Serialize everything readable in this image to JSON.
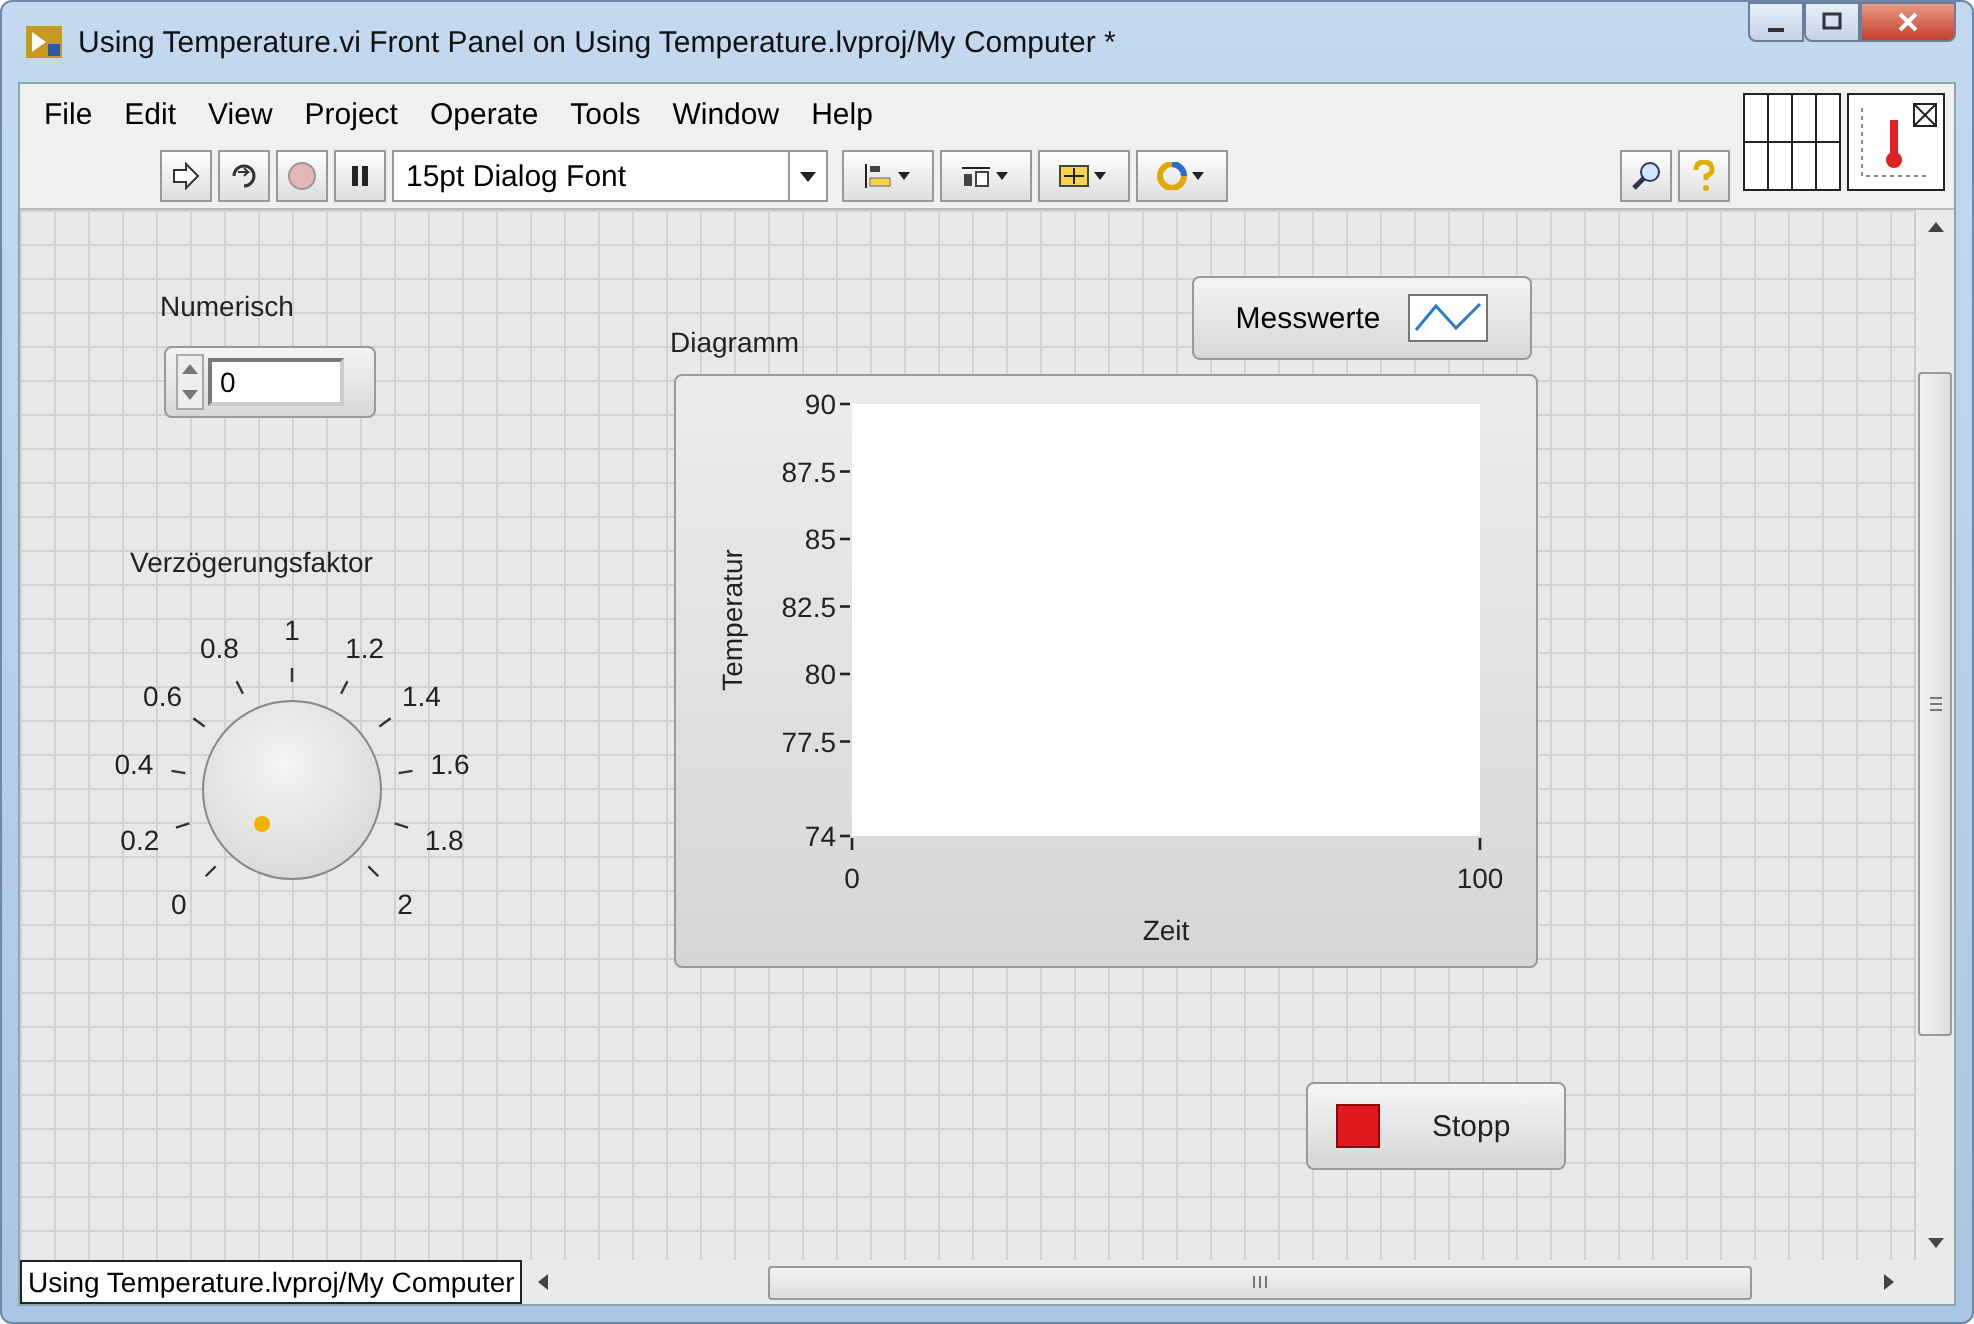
{
  "window": {
    "title": "Using Temperature.vi Front Panel on Using Temperature.lvproj/My Computer *"
  },
  "menu": [
    "File",
    "Edit",
    "View",
    "Project",
    "Operate",
    "Tools",
    "Window",
    "Help"
  ],
  "toolbar": {
    "font": "15pt Dialog Font",
    "abort_disabled": true
  },
  "panel": {
    "numeric": {
      "label": "Numerisch",
      "value": "0"
    },
    "knob": {
      "label": "Verzögerungsfaktor",
      "scale": [
        "0",
        "0.2",
        "0.4",
        "0.6",
        "0.8",
        "1",
        "1.2",
        "1.4",
        "1.6",
        "1.8",
        "2"
      ]
    },
    "chart": {
      "label": "Diagramm",
      "legend": {
        "name": "Messwerte"
      },
      "chart_data": {
        "type": "line",
        "xlabel": "Zeit",
        "ylabel": "Temperatur",
        "xlim": [
          0,
          100
        ],
        "ylim": [
          74,
          90
        ],
        "xticks": [
          0,
          100
        ],
        "yticks": [
          74,
          77.5,
          80,
          82.5,
          85,
          87.5,
          90
        ]
      }
    },
    "stop_button": {
      "label": "Stopp"
    }
  },
  "status_bar": {
    "path": "Using Temperature.lvproj/My Computer"
  }
}
